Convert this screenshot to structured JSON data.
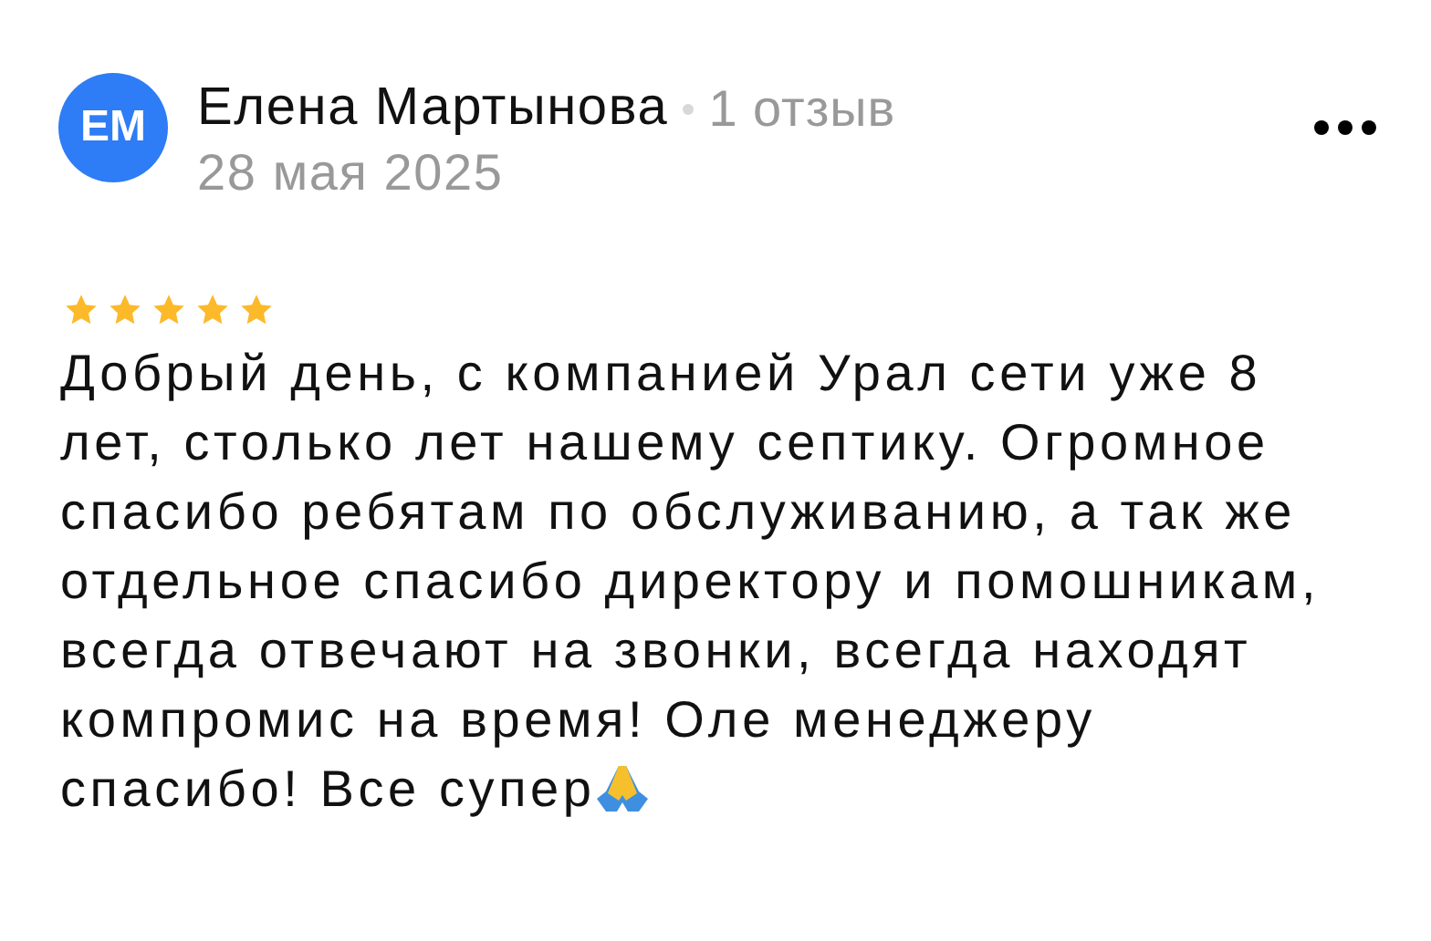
{
  "review": {
    "avatar_initials": "ЕМ",
    "author": "Елена Мартынова",
    "review_count": "1 отзыв",
    "date": "28 мая 2025",
    "stars": 5,
    "text_lines": [
      "Добрый день, с компанией Урал сети уже 8",
      "лет, столько лет нашему септику. Огромное",
      "спасибо ребятам по обслуживанию, а так же",
      "отдельное спасибо директору и помошникам,",
      "всегда отвечают на звонки, всегда находят",
      "компромис на время! Оле менеджеру",
      "спасибо! Все супер"
    ]
  }
}
